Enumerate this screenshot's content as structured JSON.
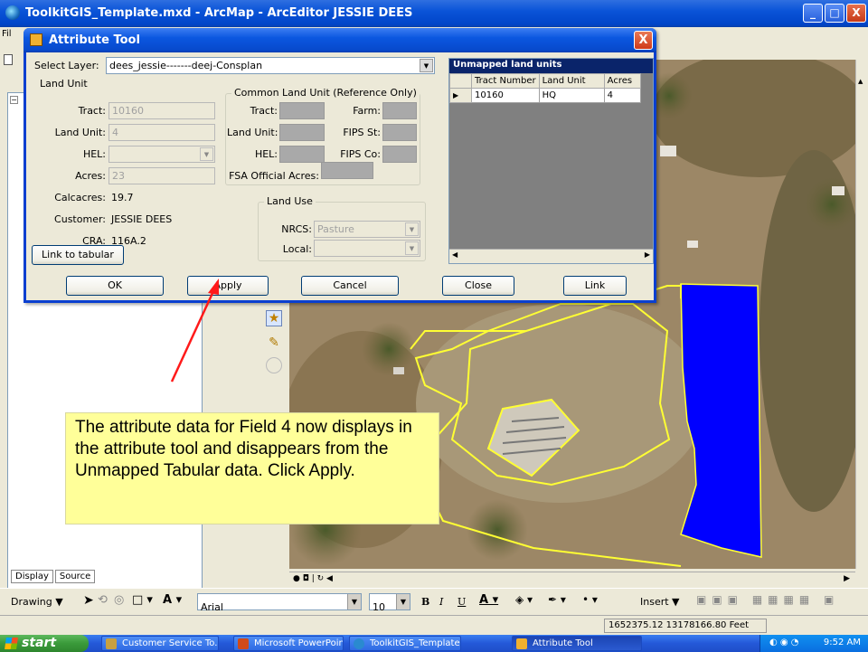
{
  "window": {
    "title": "ToolkitGIS_Template.mxd - ArcMap - ArcEditor     JESSIE DEES",
    "min": "_",
    "max": "□",
    "close": "X"
  },
  "left_panel": {
    "tab_display": "Display",
    "tab_source": "Source"
  },
  "dialog": {
    "title": "Attribute Tool",
    "close": "X",
    "select_layer_label": "Select Layer:",
    "select_layer_value": "dees_jessie-------deej-Consplan",
    "land_unit": {
      "group_title": "Land Unit",
      "tract_label": "Tract:",
      "tract_value": "10160",
      "land_unit_label": "Land Unit:",
      "land_unit_value": "4",
      "hel_label": "HEL:",
      "hel_value": "",
      "acres_label": "Acres:",
      "acres_value": "23",
      "calcacres_label": "Calcacres:",
      "calcacres_value": "19.7",
      "customer_label": "Customer:",
      "customer_value": "JESSIE DEES",
      "cra_label": "CRA:",
      "cra_value": "116A.2",
      "link_to_tabular": "Link to tabular"
    },
    "clu": {
      "group_title": "Common Land Unit (Reference Only)",
      "tract_label": "Tract:",
      "farm_label": "Farm:",
      "land_unit_label": "Land Unit:",
      "fips_st_label": "FIPS St:",
      "hel_label": "HEL:",
      "fips_co_label": "FIPS Co:",
      "fsa_acres_label": "FSA Official Acres:"
    },
    "land_use": {
      "group_title": "Land Use",
      "nrcs_label": "NRCS:",
      "nrcs_value": "Pasture",
      "local_label": "Local:",
      "local_value": ""
    },
    "unmapped": {
      "caption": "Unmapped land units",
      "columns": [
        "Tract Number",
        "Land Unit",
        "Acres"
      ],
      "rows": [
        {
          "tract": "10160",
          "land_unit": "HQ",
          "acres": "4"
        }
      ]
    },
    "buttons": {
      "ok": "OK",
      "apply": "Apply",
      "cancel": "Cancel",
      "close": "Close",
      "link": "Link"
    }
  },
  "callout": {
    "text": "The attribute data for Field 4 now displays in the attribute tool and disappears from the Unmapped Tabular data. Click Apply."
  },
  "draw_toolbar": {
    "drawing": "Drawing ▼",
    "font_name": "Arial",
    "font_size": "10",
    "bold": "B",
    "italic": "I",
    "underline": "U",
    "insert": "Insert ▼"
  },
  "status": {
    "coords": "1652375.12  13178166.80 Feet"
  },
  "taskbar": {
    "start": "start",
    "items": [
      {
        "label": "Customer Service To...",
        "color": "#c8a040"
      },
      {
        "label": "Microsoft PowerPoint ...",
        "color": "#d04a1a"
      },
      {
        "label": "ToolkitGIS_Template....",
        "color": "#2a8ad0"
      },
      {
        "label": "Attribute Tool",
        "color": "#f0b030"
      }
    ],
    "clock": "9:52 AM"
  }
}
